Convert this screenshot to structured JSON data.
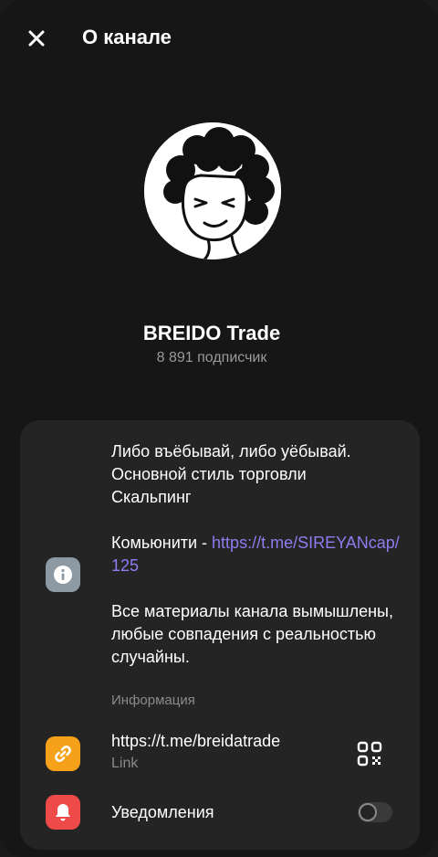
{
  "header": {
    "title": "О канале",
    "close_icon": "close-icon"
  },
  "channel": {
    "name": "BREIDO Trade",
    "subscribers": "8 891 подписчик"
  },
  "info": {
    "line1": "Либо въёбывай, либо уёбывай.",
    "line2": "Основной стиль торговли",
    "line3": "Скальпинг",
    "community_prefix": "Комьюнити - ",
    "community_link": "https://t.me/SIREYANcap/125",
    "disclaimer": "Все материалы канала вымышлены, любые совпадения с реальностью случайны.",
    "label": "Информация",
    "icon": "info-icon"
  },
  "link": {
    "url": "https://t.me/breidatrade",
    "label": "Link",
    "icon": "link-icon",
    "qr_icon": "qr-code-icon"
  },
  "notifications": {
    "label": "Уведомления",
    "icon": "bell-icon",
    "enabled": false
  },
  "colors": {
    "background": "#161616",
    "card": "#242424",
    "link_accent": "#8e7cf0",
    "info_icon_bg": "#8e9aa3",
    "link_icon_bg": "#f5a21a",
    "bell_icon_bg": "#ef4a4a"
  }
}
